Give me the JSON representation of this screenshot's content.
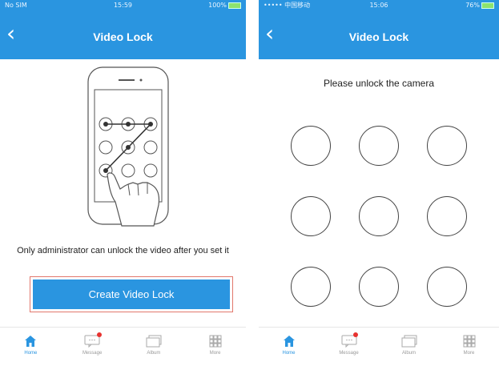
{
  "left_screen": {
    "status": {
      "carrier": "No SIM",
      "time": "15:59",
      "battery": "100%"
    },
    "title": "Video Lock",
    "description": "Only administrator can unlock the video after you set it",
    "create_button": "Create Video Lock"
  },
  "right_screen": {
    "status": {
      "carrier": "••••• 中国移动",
      "time": "15:06",
      "battery": "76%"
    },
    "title": "Video Lock",
    "prompt": "Please unlock the camera"
  },
  "tabs": [
    {
      "label": "Home",
      "icon": "home-icon",
      "active": true
    },
    {
      "label": "Message",
      "icon": "message-icon",
      "badge": true
    },
    {
      "label": "Album",
      "icon": "album-icon"
    },
    {
      "label": "More",
      "icon": "more-icon"
    }
  ],
  "colors": {
    "accent": "#2a95e0",
    "badge": "#e8322f",
    "highlight_border": "#e2776c"
  }
}
